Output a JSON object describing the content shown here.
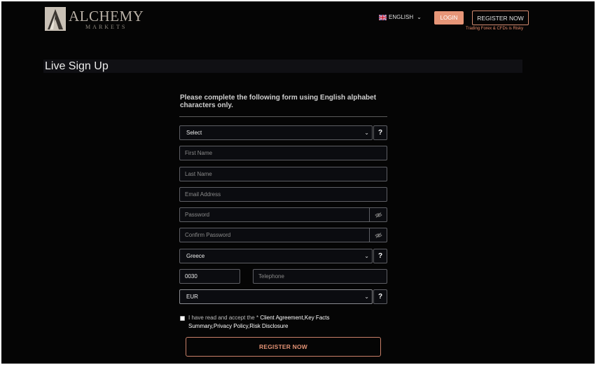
{
  "header": {
    "logo_name": "ALCHEMY",
    "logo_sub": "MARKETS",
    "language_label": "ENGLISH",
    "login_label": "LOGIN",
    "register_label": "REGISTER NOW",
    "risk_warning": "Trading Forex & CFDs is Risky"
  },
  "page": {
    "title": "Live Sign Up"
  },
  "form": {
    "intro": "Please complete the following form using English alphabet characters only.",
    "account_type": {
      "value": "Select"
    },
    "first_name": {
      "placeholder": "First Name"
    },
    "last_name": {
      "placeholder": "Last Name"
    },
    "email": {
      "placeholder": "Email Address"
    },
    "password": {
      "placeholder": "Password"
    },
    "confirm_password": {
      "placeholder": "Confirm Password"
    },
    "country": {
      "value": "Greece"
    },
    "phone_code": {
      "value": "0030"
    },
    "telephone": {
      "placeholder": "Telephone"
    },
    "currency": {
      "value": "EUR"
    },
    "help_label": "?",
    "agree_prefix": "I have read and accept the ",
    "agree_asterisk": "*",
    "agree_links": "Client Agreement,Key Facts Summary,Privacy Policy,Risk Disclosure",
    "submit_label": "REGISTER NOW"
  },
  "icons": {
    "logo": "alchemy-logo-icon",
    "flag": "uk-flag-icon",
    "chevron": "chevron-down-icon",
    "eye": "eye-slash-icon"
  },
  "colors": {
    "background": "#050505",
    "accent": "#e79678",
    "field_border": "#5e5f64"
  }
}
